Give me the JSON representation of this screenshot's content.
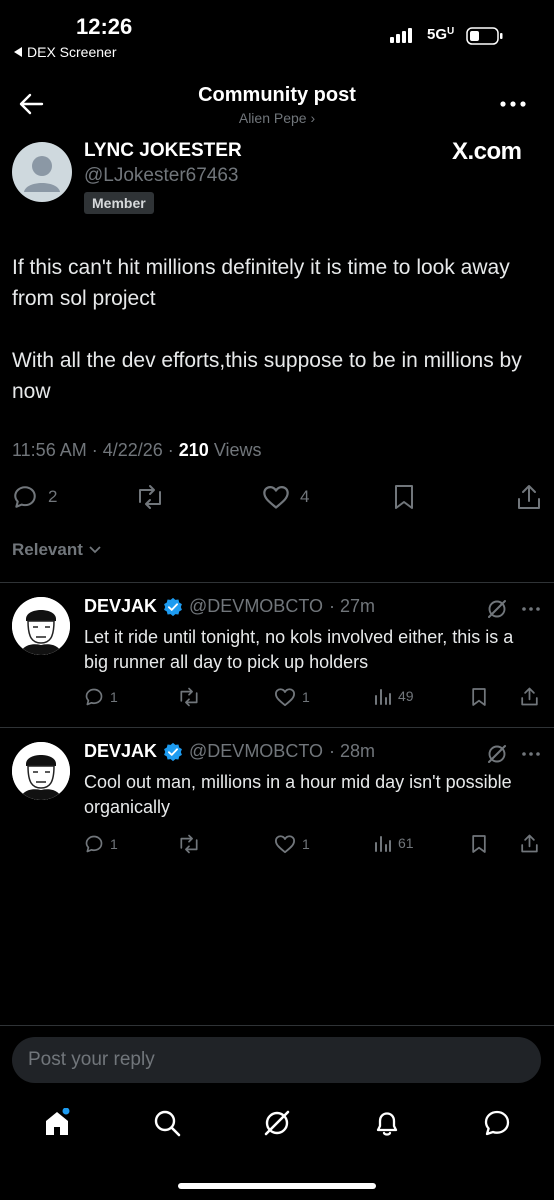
{
  "status_bar": {
    "time": "12:26",
    "back_app": "DEX Screener",
    "network": "5G"
  },
  "header": {
    "title": "Community post",
    "community": "Alien Pepe ›"
  },
  "post": {
    "author_name": "LYNC JOKESTER",
    "author_handle": "@LJokester67463",
    "badge": "Member",
    "source": "X.com",
    "paragraphs": [
      "If this can't hit millions definitely it is time to look away from sol project",
      "With all the dev efforts,this suppose to be in millions by now"
    ],
    "time": "11:56 AM · 4/22/26 · ",
    "views_count": "210",
    "views_label": " Views",
    "replies": "2",
    "likes": "4"
  },
  "sort_label": "Relevant",
  "replies": [
    {
      "name": "DEVJAK",
      "handle": "@DEVMOBCTO",
      "age": "· 27m",
      "text": "Let it ride until tonight, no kols involved either, this is a big runner all day to pick up holders",
      "replies": "1",
      "likes": "1",
      "views": "49"
    },
    {
      "name": "DEVJAK",
      "handle": "@DEVMOBCTO",
      "age": "· 28m",
      "text": "Cool out man, millions in a hour mid day isn't possible organically",
      "replies": "1",
      "likes": "1",
      "views": "61"
    }
  ],
  "reply_input": {
    "placeholder": "Post your reply"
  },
  "colors": {
    "background": "#000000",
    "muted": "#71767b",
    "verified": "#1d9bf0",
    "divider": "#2f3336"
  },
  "icons": [
    "back-arrow-icon",
    "more-icon",
    "reply-icon",
    "repost-icon",
    "like-icon",
    "bookmark-icon",
    "share-icon",
    "verified-icon",
    "grok-icon",
    "views-icon",
    "home-icon",
    "search-icon",
    "notifications-icon",
    "messages-icon"
  ]
}
